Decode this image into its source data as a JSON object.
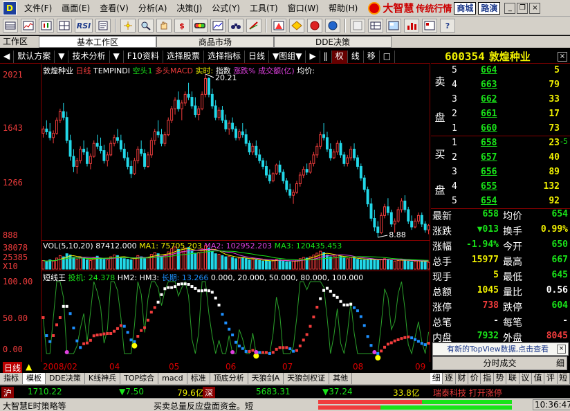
{
  "app": {
    "icon_label": "D"
  },
  "menu": [
    "文件(F)",
    "画面(E)",
    "查看(V)",
    "分析(A)",
    "决策(J)",
    "公式(Y)",
    "工具(T)",
    "窗口(W)",
    "帮助(H)"
  ],
  "brand": {
    "name": "大智慧",
    "slogan": "传统行情",
    "btn_market": "商城",
    "btn_route": "路演"
  },
  "window_controls": {
    "minimize": "_",
    "restore": "❐",
    "close": "×"
  },
  "toolbar": {
    "rsi_label": "RSI",
    "dollar_label": "$",
    "help_label": "?"
  },
  "workspace": {
    "label": "工作区",
    "tabs": [
      "基本工作区",
      "商品市场",
      "DDE决策"
    ]
  },
  "chart_tools": [
    "◀",
    "默认方案",
    "▼",
    "技术分析",
    "▼",
    "F10资料",
    "选择股票",
    "选择指标",
    "日线",
    "▼图组▼",
    "▶",
    "‖",
    "权",
    "线",
    "移",
    "□"
  ],
  "chart": {
    "stock_name": "敦煌种业",
    "period": "日线",
    "template": "TEMPINDI",
    "signal_empty": "空头1",
    "signal_bull": "多头MACD",
    "realtime_label": "实时:",
    "index_label": "指数",
    "change_label": "涨跌%",
    "amount_label": "成交额(亿)",
    "avg_label": "均价:",
    "high_marker": "20.21",
    "low_marker": "8.88",
    "price_axis": [
      "2021",
      "1643",
      "1266",
      "888"
    ],
    "vol_axis": [
      "38078",
      "25385",
      "X10"
    ],
    "vol_legend": {
      "title": "VOL(5,10,20)",
      "vol": "87412.000",
      "ma1": "MA1: 75705.203",
      "ma2": "MA2: 102952.203",
      "ma3": "MA3: 120435.453"
    },
    "osc_axis": [
      "100.00",
      "50.00",
      "0.00"
    ],
    "osc_legend": {
      "title": "短线王",
      "ind1": "投机: 24.378",
      "ind2": "HM2:",
      "ind3": "HM3:",
      "ind4": "长期: 13.266",
      "levels": "0.000, 20.000, 50.000, 80.000, 100.000"
    },
    "dates": [
      "2008/02",
      "04",
      "05",
      "06",
      "07",
      "08",
      "09"
    ],
    "period_tag": "日线"
  },
  "chart_data": {
    "type": "candlestick",
    "price_scale_cents": true,
    "ylim": [
      888,
      2021
    ],
    "candles": [
      [
        1610,
        1660,
        1580,
        1640
      ],
      [
        1640,
        1700,
        1600,
        1620
      ],
      [
        1620,
        1680,
        1560,
        1580
      ],
      [
        1580,
        1630,
        1540,
        1610
      ],
      [
        1610,
        1720,
        1600,
        1700
      ],
      [
        1700,
        1780,
        1680,
        1760
      ],
      [
        1760,
        1820,
        1700,
        1720
      ],
      [
        1720,
        1760,
        1540,
        1560
      ],
      [
        1560,
        1600,
        1420,
        1450
      ],
      [
        1450,
        1500,
        1340,
        1380
      ],
      [
        1380,
        1440,
        1330,
        1420
      ],
      [
        1420,
        1520,
        1400,
        1500
      ],
      [
        1500,
        1560,
        1460,
        1480
      ],
      [
        1480,
        1510,
        1380,
        1400
      ],
      [
        1400,
        1470,
        1360,
        1450
      ],
      [
        1450,
        1560,
        1440,
        1540
      ],
      [
        1540,
        1600,
        1500,
        1520
      ],
      [
        1520,
        1580,
        1470,
        1490
      ],
      [
        1490,
        1530,
        1400,
        1420
      ],
      [
        1420,
        1480,
        1380,
        1460
      ],
      [
        1460,
        1560,
        1450,
        1540
      ],
      [
        1540,
        1600,
        1520,
        1580
      ],
      [
        1580,
        1640,
        1540,
        1560
      ],
      [
        1560,
        1600,
        1480,
        1500
      ],
      [
        1500,
        1540,
        1420,
        1440
      ],
      [
        1440,
        1480,
        1360,
        1380
      ],
      [
        1380,
        1420,
        1300,
        1330
      ],
      [
        1330,
        1440,
        1320,
        1420
      ],
      [
        1420,
        1520,
        1400,
        1500
      ],
      [
        1500,
        1560,
        1450,
        1470
      ],
      [
        1470,
        1500,
        1360,
        1380
      ],
      [
        1380,
        1480,
        1370,
        1460
      ],
      [
        1460,
        1580,
        1440,
        1560
      ],
      [
        1560,
        1640,
        1530,
        1620
      ],
      [
        1620,
        1700,
        1580,
        1600
      ],
      [
        1600,
        1640,
        1520,
        1540
      ],
      [
        1540,
        1620,
        1520,
        1600
      ],
      [
        1600,
        1720,
        1590,
        1700
      ],
      [
        1700,
        1800,
        1680,
        1780
      ],
      [
        1780,
        1860,
        1740,
        1840
      ],
      [
        1840,
        1900,
        1760,
        1780
      ],
      [
        1780,
        1840,
        1700,
        1820
      ],
      [
        1820,
        1900,
        1800,
        1880
      ],
      [
        1880,
        1960,
        1840,
        1860
      ],
      [
        1860,
        1900,
        1780,
        1800
      ],
      [
        1800,
        1860,
        1720,
        1740
      ],
      [
        1740,
        1800,
        1700,
        1780
      ],
      [
        1780,
        1900,
        1770,
        1880
      ],
      [
        1880,
        2021,
        1860,
        1990
      ],
      [
        1990,
        2000,
        1860,
        1880
      ],
      [
        1880,
        1920,
        1780,
        1800
      ],
      [
        1800,
        1840,
        1700,
        1720
      ],
      [
        1720,
        1790,
        1700,
        1770
      ],
      [
        1770,
        1800,
        1680,
        1700
      ],
      [
        1700,
        1740,
        1620,
        1640
      ],
      [
        1640,
        1700,
        1600,
        1680
      ],
      [
        1680,
        1720,
        1620,
        1640
      ],
      [
        1640,
        1660,
        1560,
        1580
      ],
      [
        1580,
        1640,
        1560,
        1620
      ],
      [
        1620,
        1680,
        1580,
        1600
      ],
      [
        1600,
        1640,
        1520,
        1540
      ],
      [
        1540,
        1560,
        1460,
        1480
      ],
      [
        1480,
        1540,
        1460,
        1520
      ],
      [
        1520,
        1560,
        1440,
        1460
      ],
      [
        1460,
        1500,
        1400,
        1420
      ],
      [
        1420,
        1440,
        1360,
        1380
      ],
      [
        1380,
        1420,
        1300,
        1320
      ],
      [
        1320,
        1360,
        1260,
        1280
      ],
      [
        1280,
        1340,
        1270,
        1330
      ],
      [
        1330,
        1400,
        1320,
        1390
      ],
      [
        1390,
        1420,
        1320,
        1340
      ],
      [
        1340,
        1360,
        1260,
        1280
      ],
      [
        1280,
        1300,
        1200,
        1220
      ],
      [
        1220,
        1260,
        1160,
        1180
      ],
      [
        1180,
        1220,
        1120,
        1200
      ],
      [
        1200,
        1280,
        1190,
        1260
      ],
      [
        1260,
        1340,
        1240,
        1320
      ],
      [
        1320,
        1380,
        1300,
        1360
      ],
      [
        1360,
        1400,
        1320,
        1340
      ],
      [
        1340,
        1420,
        1330,
        1400
      ],
      [
        1400,
        1480,
        1380,
        1460
      ],
      [
        1460,
        1540,
        1440,
        1520
      ],
      [
        1520,
        1620,
        1500,
        1600
      ],
      [
        1600,
        1680,
        1560,
        1580
      ],
      [
        1580,
        1620,
        1480,
        1500
      ],
      [
        1500,
        1540,
        1420,
        1440
      ],
      [
        1440,
        1500,
        1430,
        1480
      ],
      [
        1480,
        1560,
        1460,
        1540
      ],
      [
        1540,
        1560,
        1440,
        1460
      ],
      [
        1460,
        1480,
        1380,
        1400
      ],
      [
        1400,
        1460,
        1380,
        1440
      ],
      [
        1440,
        1520,
        1420,
        1500
      ],
      [
        1500,
        1540,
        1420,
        1440
      ],
      [
        1440,
        1460,
        1360,
        1380
      ],
      [
        1380,
        1400,
        1280,
        1300
      ],
      [
        1300,
        1320,
        1200,
        1220
      ],
      [
        1220,
        1240,
        1100,
        1120
      ],
      [
        1120,
        1160,
        1000,
        1020
      ],
      [
        1020,
        1080,
        930,
        960
      ],
      [
        960,
        1000,
        888,
        920
      ],
      [
        920,
        1060,
        910,
        1040
      ],
      [
        1040,
        1120,
        1020,
        1100
      ],
      [
        1100,
        1160,
        1040,
        1060
      ],
      [
        1060,
        1080,
        960,
        980
      ],
      [
        980,
        1020,
        920,
        1000
      ],
      [
        1000,
        1100,
        990,
        1080
      ],
      [
        1080,
        1160,
        1060,
        1140
      ],
      [
        1140,
        1180,
        1060,
        1080
      ],
      [
        1080,
        1100,
        980,
        1000
      ],
      [
        1000,
        1040,
        940,
        960
      ],
      [
        960,
        1020,
        950,
        1000
      ],
      [
        1000,
        1060,
        980,
        1040
      ],
      [
        1040,
        1060,
        960,
        980
      ],
      [
        980,
        1000,
        920,
        940
      ],
      [
        940,
        980,
        910,
        970
      ]
    ],
    "volumes": [
      14000,
      12000,
      15000,
      13000,
      18000,
      22000,
      20000,
      25000,
      23000,
      19000,
      16000,
      18000,
      17000,
      15000,
      14000,
      19000,
      21000,
      18000,
      16000,
      15000,
      20000,
      23000,
      22000,
      19000,
      17000,
      16000,
      15000,
      18000,
      22000,
      20000,
      17000,
      19000,
      24000,
      27000,
      25000,
      21000,
      23000,
      28000,
      33000,
      36000,
      32000,
      29000,
      34000,
      35000,
      30000,
      26000,
      27000,
      33000,
      38078,
      34000,
      29000,
      25000,
      24000,
      22000,
      20000,
      21000,
      19000,
      17000,
      18000,
      19000,
      17000,
      15000,
      16000,
      15000,
      14000,
      13000,
      14000,
      13000,
      14000,
      16000,
      15000,
      13000,
      12000,
      12000,
      13000,
      15000,
      17000,
      19000,
      18000,
      20000,
      23000,
      26000,
      29000,
      27000,
      23000,
      20000,
      21000,
      23000,
      21000,
      18000,
      17000,
      19000,
      18000,
      16000,
      15000,
      15000,
      16000,
      17000,
      15000,
      14000,
      15000,
      17000,
      16000,
      14000,
      13000,
      14000,
      16000,
      15000,
      13000,
      12000,
      13000,
      14000,
      13000,
      12000,
      11000
    ]
  },
  "quote": {
    "code": "600354",
    "name": "敦煌种业",
    "close_btn": "×",
    "ask_label": "卖盘",
    "bid_label": "买盘",
    "asks": [
      {
        "lv": "5",
        "price": "664",
        "vol": "5"
      },
      {
        "lv": "4",
        "price": "663",
        "vol": "79"
      },
      {
        "lv": "3",
        "price": "662",
        "vol": "33"
      },
      {
        "lv": "2",
        "price": "661",
        "vol": "17"
      },
      {
        "lv": "1",
        "price": "660",
        "vol": "73"
      }
    ],
    "bids": [
      {
        "lv": "1",
        "price": "658",
        "vol": "23"
      },
      {
        "lv": "2",
        "price": "657",
        "vol": "40"
      },
      {
        "lv": "3",
        "price": "656",
        "vol": "89"
      },
      {
        "lv": "4",
        "price": "655",
        "vol": "132"
      },
      {
        "lv": "5",
        "price": "654",
        "vol": "92"
      }
    ],
    "bid1_change": "-5",
    "stats": [
      {
        "k": "最新",
        "v": "658",
        "vc": "g",
        "k2": "均价",
        "v2": "654",
        "v2c": "g"
      },
      {
        "k": "涨跌",
        "v": "▼013",
        "vc": "g",
        "k2": "换手",
        "v2": "0.99%",
        "v2c": "y"
      },
      {
        "k": "涨幅",
        "v": "-1.94%",
        "vc": "g",
        "k2": "今开",
        "v2": "650",
        "v2c": "g"
      },
      {
        "k": "总手",
        "v": "15977",
        "vc": "y",
        "k2": "最高",
        "v2": "667",
        "v2c": "g"
      },
      {
        "k": "现手",
        "v": "5",
        "vc": "y",
        "k2": "最低",
        "v2": "645",
        "v2c": "g"
      },
      {
        "k": "总额",
        "v": "1045",
        "vc": "y",
        "k2": "量比",
        "v2": "0.56",
        "v2c": "w"
      },
      {
        "k": "涨停",
        "v": "738",
        "vc": "r",
        "k2": "跌停",
        "v2": "604",
        "v2c": "g"
      },
      {
        "k": "总笔",
        "v": "-",
        "vc": "w",
        "k2": "每笔",
        "v2": "-",
        "v2c": "w"
      },
      {
        "k": "内盘",
        "v": "7932",
        "vc": "g",
        "k2": "外盘",
        "v2": "8045",
        "v2c": "r"
      }
    ],
    "notice": "有新的TopView数据,点击查看",
    "notice_close": "×",
    "trades_btn": "分时成交",
    "trades_right": "细"
  },
  "bottom_tabs": [
    "指标",
    "模板",
    "DDE决策",
    "K线神兵",
    "TOP综合",
    "macd",
    "标准",
    "顶底分析",
    "天狼剑A",
    "天狼剑权证",
    "其他"
  ],
  "right_tabs": [
    "细",
    "逐",
    "财",
    "价",
    "指",
    "势",
    "联",
    "议",
    "值",
    "评",
    "短"
  ],
  "index_bar": {
    "sh_label": "沪",
    "sh_value": "1710.22",
    "sh_change": "▼7.50",
    "sh_amount": "79.6亿",
    "sz_label": "深",
    "sz_value": "5683.31",
    "sz_change": "▼37.24",
    "sz_amount": "33.8亿",
    "scroll_news": "瑞泰科技 打开涨停"
  },
  "status": {
    "left": "大智慧E时策略等",
    "scroll": "买卖总量反应盘面资金。短",
    "time": "10:36:47"
  },
  "colors": {
    "up": "#f03c3c",
    "down": "#19e419",
    "price_yellow": "#f0f000",
    "cyan_candle": "#22d8e8",
    "frame_red": "#800000"
  }
}
